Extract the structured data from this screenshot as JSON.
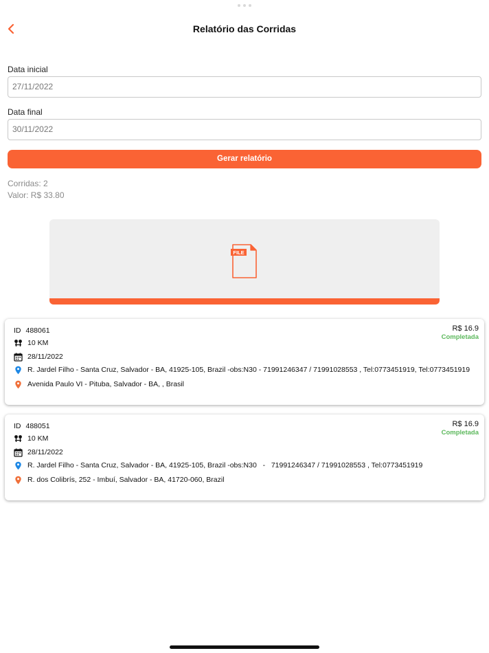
{
  "header": {
    "title": "Relatório das Corridas"
  },
  "form": {
    "start_label": "Data inicial",
    "start_value": "27/11/2022",
    "end_label": "Data final",
    "end_value": "30/11/2022",
    "submit_label": "Gerar relatório"
  },
  "summary": {
    "rides": "Corridas: 2",
    "value": "Valor: R$ 33.80"
  },
  "file_panel": {
    "icon_text": "FILE"
  },
  "rides": [
    {
      "id_label": "ID",
      "id": "488061",
      "distance": "10 KM",
      "date": "28/11/2022",
      "origin": "R. Jardel Filho - Santa Cruz, Salvador - BA, 41925-105, Brazil -obs:N30 - 71991246347 / 71991028553 , Tel:0773451919, Tel:0773451919",
      "destination": "Avenida Paulo VI - Pituba, Salvador - BA, , Brasil",
      "price": "R$ 16.9",
      "status": "Completada"
    },
    {
      "id_label": "ID",
      "id": "488051",
      "distance": "10 KM",
      "date": "28/11/2022",
      "origin": "R. Jardel Filho - Santa Cruz, Salvador - BA, 41925-105, Brazil -obs:N30   -   71991246347 / 71991028553 , Tel:0773451919",
      "destination": "R. dos Colibrís, 252 - Imbuí, Salvador - BA, 41720-060, Brazil",
      "price": "R$ 16.9",
      "status": "Completada"
    }
  ],
  "colors": {
    "accent": "#fa6334",
    "status_complete": "#5cb85c",
    "origin_pin": "#1e88e5",
    "destination_pin": "#f0703a"
  }
}
